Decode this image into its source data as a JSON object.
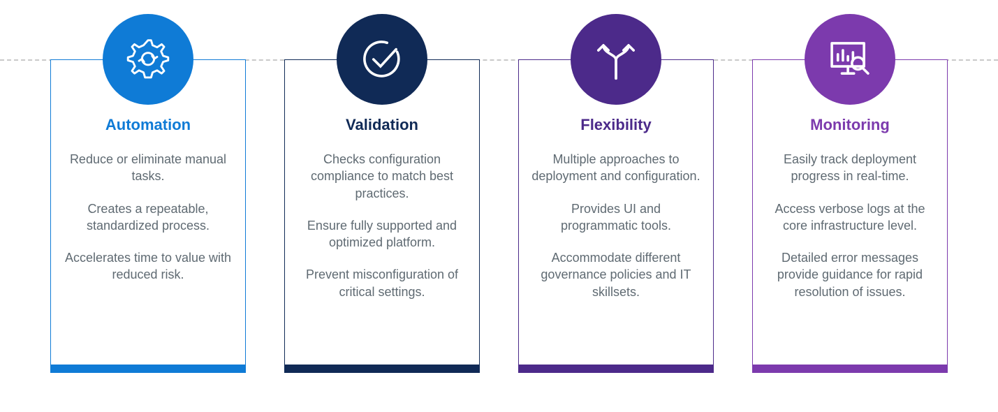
{
  "cards": [
    {
      "id": "automation",
      "title": "Automation",
      "icon": "gear-cycle-icon",
      "color": "#0f7bd6",
      "paragraphs": [
        "Reduce or eliminate manual tasks.",
        "Creates a repeatable, standardized process.",
        "Accelerates time to value with reduced risk."
      ]
    },
    {
      "id": "validation",
      "title": "Validation",
      "icon": "checkmark-circle-icon",
      "color": "#102a56",
      "paragraphs": [
        "Checks configuration compliance to match best practices.",
        "Ensure fully supported and optimized platform.",
        "Prevent misconfiguration of critical settings."
      ]
    },
    {
      "id": "flexibility",
      "title": "Flexibility",
      "icon": "fork-arrows-icon",
      "color": "#4c2a8a",
      "paragraphs": [
        "Multiple approaches to deployment and configuration.",
        "Provides UI and programmatic tools.",
        "Accommodate different governance policies and IT skillsets."
      ]
    },
    {
      "id": "monitoring",
      "title": "Monitoring",
      "icon": "monitor-search-icon",
      "color": "#7c3aad",
      "paragraphs": [
        "Easily track deployment progress in real-time.",
        "Access verbose logs at the core infrastructure level.",
        "Detailed error messages provide guidance for rapid resolution of issues."
      ]
    }
  ]
}
